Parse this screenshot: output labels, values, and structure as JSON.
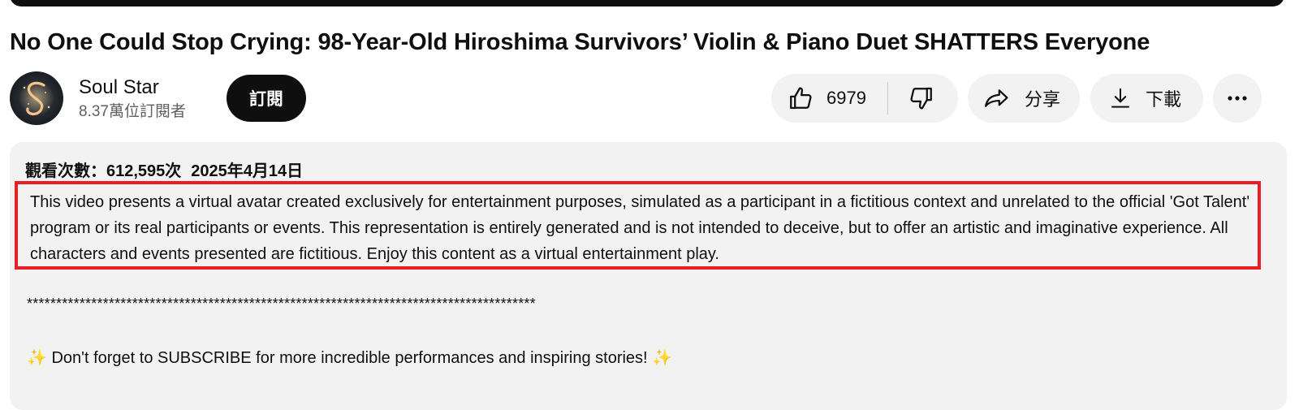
{
  "video": {
    "title": "No One Could Stop Crying: 98-Year-Old Hiroshima Survivors’ Violin & Piano Duet SHATTERS Everyone"
  },
  "channel": {
    "name": "Soul Star",
    "subscribers": "8.37萬位訂閱者",
    "avatar_letter": "S",
    "subscribe_label": "訂閱"
  },
  "actions": {
    "like_count": "6979",
    "like_icon": "thumb-up-icon",
    "dislike_icon": "thumb-down-icon",
    "share_label": "分享",
    "share_icon": "share-icon",
    "download_label": "下載",
    "download_icon": "download-icon",
    "more_icon": "more-horizontal-icon"
  },
  "description": {
    "views": "觀看次數：612,595次",
    "date": "2025年4月14日",
    "disclaimer": "This video presents a virtual avatar created exclusively for entertainment purposes, simulated as a participant in a fictitious context and unrelated to the official 'Got Talent' program or its real participants or events. This representation is entirely generated and is not intended to deceive, but to offer an artistic and imaginative experience. All characters and events presented are fictitious. Enjoy this content as a virtual entertainment play.",
    "separator": "***************************************************************************************",
    "cta_sparkle": "✨",
    "cta_text": "Don't forget to SUBSCRIBE for more incredible performances and inspiring stories!"
  },
  "colors": {
    "highlight_border": "#ea1c24",
    "button_bg": "#f2f2f2",
    "subscribe_bg": "#0f0f0f"
  }
}
